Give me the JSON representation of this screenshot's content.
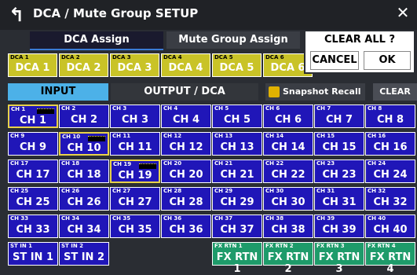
{
  "title": "DCA / Mute Group SETUP",
  "tabs": [
    "DCA Assign",
    "Mute Group Assign"
  ],
  "dca": [
    {
      "small": "DCA 1",
      "label": "DCA 1"
    },
    {
      "small": "DCA 2",
      "label": "DCA 2"
    },
    {
      "small": "DCA 3",
      "label": "DCA 3"
    },
    {
      "small": "DCA 4",
      "label": "DCA 4"
    },
    {
      "small": "DCA 5",
      "label": "DCA 5"
    },
    {
      "small": "DCA 6",
      "label": "DCA 6"
    }
  ],
  "segments": {
    "input": "INPUT",
    "output": "OUTPUT / DCA"
  },
  "snapshot_label": "Snapshot Recall Safe",
  "clear_all_label": "CLEAR ALL",
  "popup": {
    "title": "CLEAR ALL ?",
    "cancel": "CANCEL",
    "ok": "OK"
  },
  "channels": [
    {
      "small": "CH 1",
      "label": "CH 1",
      "sel": true
    },
    {
      "small": "CH 2",
      "label": "CH 2"
    },
    {
      "small": "CH 3",
      "label": "CH 3"
    },
    {
      "small": "CH 4",
      "label": "CH 4"
    },
    {
      "small": "CH 5",
      "label": "CH 5"
    },
    {
      "small": "CH 6",
      "label": "CH 6"
    },
    {
      "small": "CH 7",
      "label": "CH 7"
    },
    {
      "small": "CH 8",
      "label": "CH 8"
    },
    {
      "small": "CH 9",
      "label": "CH 9"
    },
    {
      "small": "CH 10",
      "label": "CH 10",
      "sel": true
    },
    {
      "small": "CH 11",
      "label": "CH 11"
    },
    {
      "small": "CH 12",
      "label": "CH 12"
    },
    {
      "small": "CH 13",
      "label": "CH 13"
    },
    {
      "small": "CH 14",
      "label": "CH 14"
    },
    {
      "small": "CH 15",
      "label": "CH 15"
    },
    {
      "small": "CH 16",
      "label": "CH 16"
    },
    {
      "small": "CH 17",
      "label": "CH 17"
    },
    {
      "small": "CH 18",
      "label": "CH 18"
    },
    {
      "small": "CH 19",
      "label": "CH 19",
      "sel": true
    },
    {
      "small": "CH 20",
      "label": "CH 20"
    },
    {
      "small": "CH 21",
      "label": "CH 21"
    },
    {
      "small": "CH 22",
      "label": "CH 22"
    },
    {
      "small": "CH 23",
      "label": "CH 23"
    },
    {
      "small": "CH 24",
      "label": "CH 24"
    },
    {
      "small": "CH 25",
      "label": "CH 25"
    },
    {
      "small": "CH 26",
      "label": "CH 26"
    },
    {
      "small": "CH 27",
      "label": "CH 27"
    },
    {
      "small": "CH 28",
      "label": "CH 28"
    },
    {
      "small": "CH 29",
      "label": "CH 29"
    },
    {
      "small": "CH 30",
      "label": "CH 30"
    },
    {
      "small": "CH 31",
      "label": "CH 31"
    },
    {
      "small": "CH 32",
      "label": "CH 32"
    },
    {
      "small": "CH 33",
      "label": "CH 33"
    },
    {
      "small": "CH 34",
      "label": "CH 34"
    },
    {
      "small": "CH 35",
      "label": "CH 35"
    },
    {
      "small": "CH 36",
      "label": "CH 36"
    },
    {
      "small": "CH 37",
      "label": "CH 37"
    },
    {
      "small": "CH 38",
      "label": "CH 38"
    },
    {
      "small": "CH 39",
      "label": "CH 39"
    },
    {
      "small": "CH 40",
      "label": "CH 40"
    }
  ],
  "bottom_row": [
    {
      "small": "ST IN 1",
      "label": "ST IN 1",
      "type": "st",
      "col": 0
    },
    {
      "small": "ST IN 2",
      "label": "ST IN 2",
      "type": "st",
      "col": 1
    },
    {
      "small": "FX RTN 1",
      "label": "FX RTN 1",
      "type": "fx",
      "col": 4
    },
    {
      "small": "FX RTN 2",
      "label": "FX RTN 2",
      "type": "fx",
      "col": 5
    },
    {
      "small": "FX RTN 3",
      "label": "FX RTN 3",
      "type": "fx",
      "col": 6
    },
    {
      "small": "FX RTN 4",
      "label": "FX RTN 4",
      "type": "fx",
      "col": 7
    }
  ]
}
